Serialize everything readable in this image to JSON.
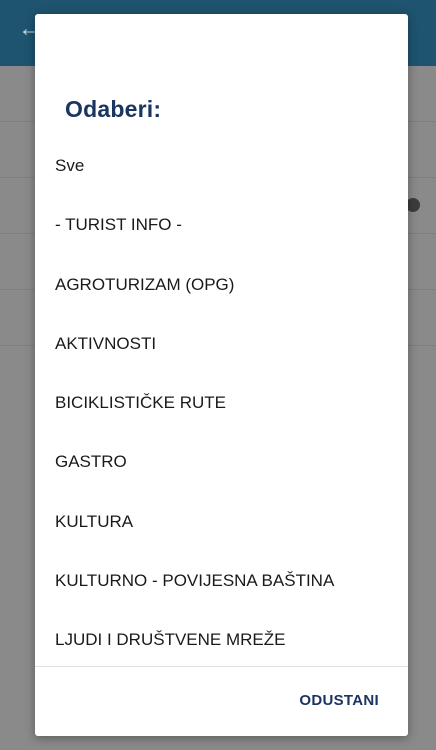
{
  "dialog": {
    "title": "Odaberi:",
    "options": [
      "Sve",
      "- TURIST INFO -",
      "AGROTURIZAM (OPG)",
      "AKTIVNOSTI",
      "BICIKLISTIČKE RUTE",
      "GASTRO",
      "KULTURA",
      "KULTURNO - POVIJESNA BAŠTINA",
      "LJUDI I DRUŠTVENE MREŽE"
    ],
    "cancel_label": "ODUSTANI"
  },
  "colors": {
    "header": "#1e5470",
    "dialog_accent": "#1b3561",
    "overlay": "#8a8a8a"
  },
  "icons": {
    "back": "arrow-left-icon"
  }
}
